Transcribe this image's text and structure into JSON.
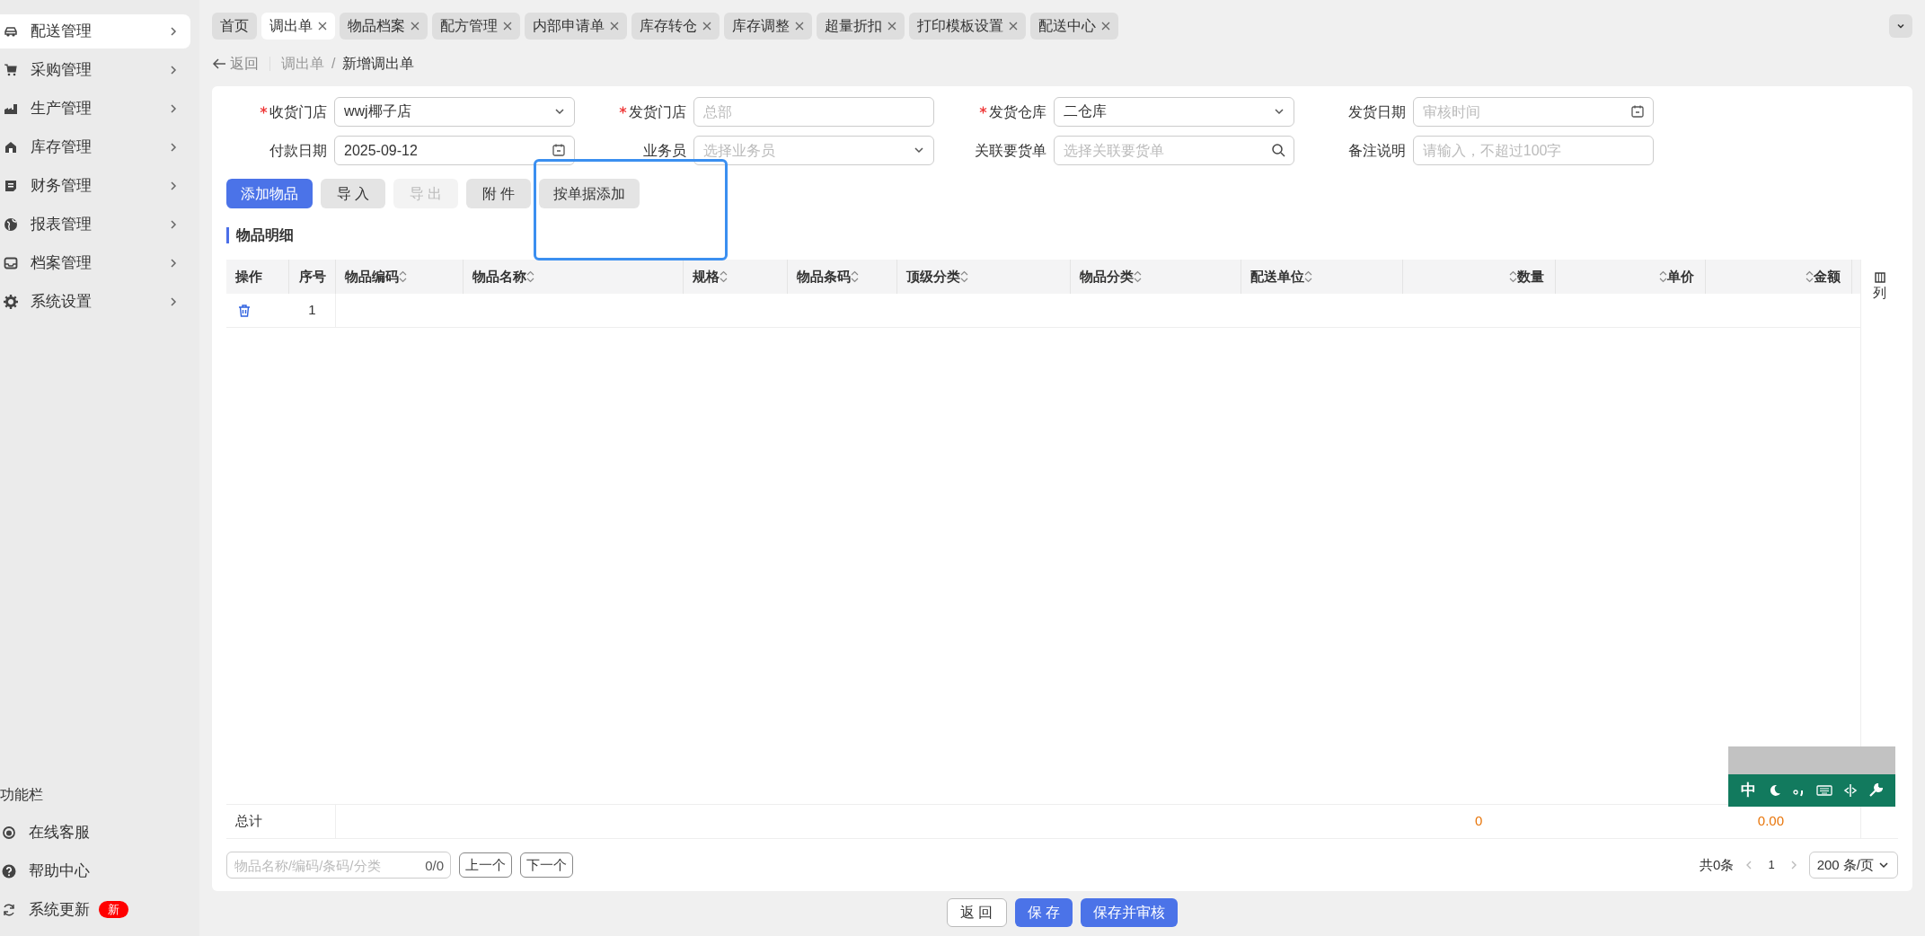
{
  "sidebar": {
    "items": [
      {
        "label": "配送管理",
        "selected": true
      },
      {
        "label": "采购管理",
        "selected": false
      },
      {
        "label": "生产管理",
        "selected": false
      },
      {
        "label": "库存管理",
        "selected": false
      },
      {
        "label": "财务管理",
        "selected": false
      },
      {
        "label": "报表管理",
        "selected": false
      },
      {
        "label": "档案管理",
        "selected": false
      },
      {
        "label": "系统设置",
        "selected": false
      }
    ],
    "footer_title": "功能栏",
    "footer_items": [
      {
        "label": "在线客服"
      },
      {
        "label": "帮助中心"
      },
      {
        "label": "系统更新",
        "badge": "新"
      }
    ]
  },
  "tabs": [
    {
      "label": "首页",
      "closable": false,
      "selected": false
    },
    {
      "label": "调出单",
      "closable": true,
      "selected": true
    },
    {
      "label": "物品档案",
      "closable": true,
      "selected": false
    },
    {
      "label": "配方管理",
      "closable": true,
      "selected": false
    },
    {
      "label": "内部申请单",
      "closable": true,
      "selected": false
    },
    {
      "label": "库存转仓",
      "closable": true,
      "selected": false
    },
    {
      "label": "库存调整",
      "closable": true,
      "selected": false
    },
    {
      "label": "超量折扣",
      "closable": true,
      "selected": false
    },
    {
      "label": "打印模板设置",
      "closable": true,
      "selected": false
    },
    {
      "label": "配送中心",
      "closable": true,
      "selected": false
    }
  ],
  "back_link": "返回",
  "breadcrumb": [
    "调出单",
    "新增调出单"
  ],
  "breadcrumb_separator": "/",
  "form_fields": [
    {
      "label": "收货门店",
      "required": true,
      "kind": "select",
      "value": "wwj椰子店"
    },
    {
      "label": "发货门店",
      "required": true,
      "kind": "text",
      "placeholder": "总部"
    },
    {
      "label": "发货仓库",
      "required": true,
      "kind": "select",
      "value": "二仓库"
    },
    {
      "label": "发货日期",
      "required": false,
      "kind": "date",
      "placeholder": "审核时间"
    },
    {
      "label": "付款日期",
      "required": false,
      "kind": "date",
      "value": "2025-09-12"
    },
    {
      "label": "业务员",
      "required": false,
      "kind": "select",
      "placeholder": "选择业务员"
    },
    {
      "label": "关联要货单",
      "required": false,
      "kind": "search",
      "placeholder": "选择关联要货单"
    },
    {
      "label": "备注说明",
      "required": false,
      "kind": "text",
      "placeholder": "请输入，不超过100字"
    }
  ],
  "actions": [
    {
      "label": "添加物品",
      "kind": "primary",
      "disabled": false
    },
    {
      "label": "导 入",
      "kind": "default",
      "disabled": false
    },
    {
      "label": "导 出",
      "kind": "default",
      "disabled": true
    },
    {
      "label": "附 件",
      "kind": "default",
      "disabled": false
    },
    {
      "label": "按单据添加",
      "kind": "default",
      "disabled": false
    }
  ],
  "section_title": "物品明细",
  "table": {
    "columns": [
      {
        "label": "操作",
        "sortable": false
      },
      {
        "label": "序号",
        "sortable": false
      },
      {
        "label": "物品编码",
        "sortable": true
      },
      {
        "label": "物品名称",
        "sortable": true
      },
      {
        "label": "规格",
        "sortable": true
      },
      {
        "label": "物品条码",
        "sortable": true
      },
      {
        "label": "顶级分类",
        "sortable": true
      },
      {
        "label": "物品分类",
        "sortable": true
      },
      {
        "label": "配送单位",
        "sortable": true
      },
      {
        "label": "数量",
        "sortable": true
      },
      {
        "label": "单价",
        "sortable": true
      },
      {
        "label": "金额",
        "sortable": true
      }
    ],
    "column_settings": "列",
    "rows": [
      {
        "index": "1"
      }
    ],
    "total_label": "总计",
    "total_quantity": "0",
    "total_amount": "0.00"
  },
  "finder": {
    "placeholder": "物品名称/编码/条码/分类",
    "count": "0/0",
    "prev": "上一个",
    "next": "下一个"
  },
  "pagination": {
    "total": "共0条",
    "page": "1",
    "page_size": "200 条/页"
  },
  "footer_buttons": [
    {
      "label": "返 回",
      "kind": "default"
    },
    {
      "label": "保 存",
      "kind": "primary"
    },
    {
      "label": "保存并审核",
      "kind": "primary"
    }
  ],
  "ime_toolbar": {
    "mode": "中"
  }
}
